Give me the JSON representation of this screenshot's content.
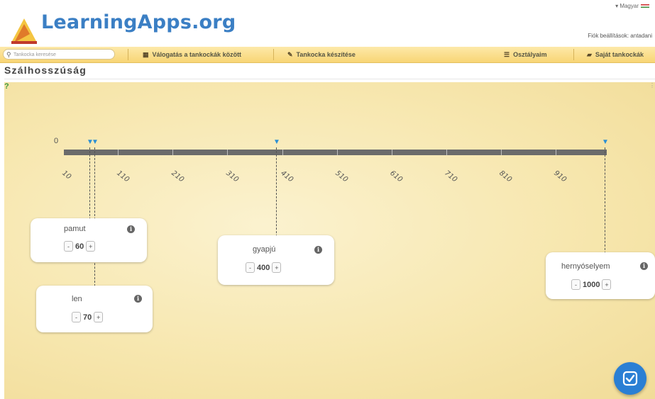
{
  "header": {
    "logo_text": "LearningApps.org",
    "language": "Magyar",
    "account": "Fiók beállítások: antadani"
  },
  "navbar": {
    "search_placeholder": "Tankocka keresése",
    "items": [
      {
        "label": "Válogatás a tankockák között",
        "icon": "grid-icon"
      },
      {
        "label": "Tankocka készítése",
        "icon": "pencil-icon"
      },
      {
        "label": "Osztályaim",
        "icon": "table-icon"
      },
      {
        "label": "Saját tankockák",
        "icon": "folder-icon"
      }
    ]
  },
  "page": {
    "title": "Szálhosszúság"
  },
  "timeline": {
    "zero_label": "0",
    "ticks": [
      "10",
      "110",
      "210",
      "310",
      "410",
      "510",
      "610",
      "710",
      "810",
      "910"
    ]
  },
  "cards": [
    {
      "label": "pamut",
      "value": "60",
      "minus": "-",
      "plus": "+"
    },
    {
      "label": "len",
      "value": "70",
      "minus": "-",
      "plus": "+"
    },
    {
      "label": "gyapjú",
      "value": "400",
      "minus": "-",
      "plus": "+"
    },
    {
      "label": "hernyóselyem",
      "value": "1000",
      "minus": "-",
      "plus": "+"
    }
  ],
  "colors": {
    "accent": "#2a7fd4",
    "navbar": "#f8d575",
    "stage": "#f7e7af"
  }
}
